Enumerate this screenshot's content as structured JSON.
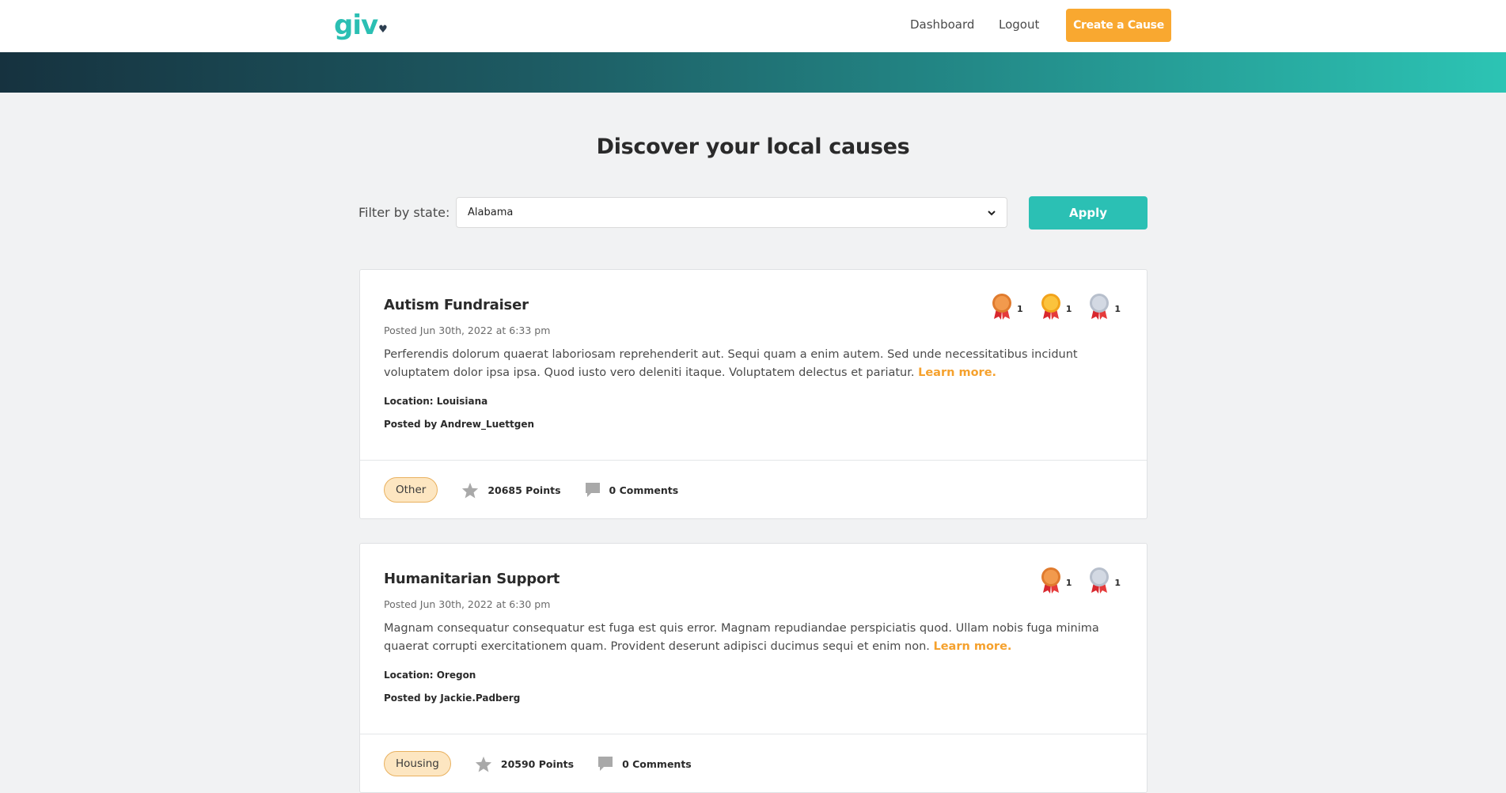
{
  "nav": {
    "logo_text": "giv",
    "logo_heart": "♥",
    "dashboard": "Dashboard",
    "logout": "Logout",
    "create_cause": "Create a Cause"
  },
  "page": {
    "title": "Discover your local causes"
  },
  "filter": {
    "label": "Filter by state:",
    "selected": "Alabama",
    "apply": "Apply"
  },
  "colors": {
    "brand_teal": "#2bc0b4",
    "accent_orange": "#f9a830",
    "tag_bg": "#fde6c1"
  },
  "causes": [
    {
      "title": "Autism Fundraiser",
      "posted": "Posted Jun 30th, 2022 at 6:33 pm",
      "description": "Perferendis dolorum quaerat laboriosam reprehenderit aut. Sequi quam a enim autem. Sed unde necessitatibus incidunt voluptatem dolor ipsa ipsa. Quod iusto vero deleniti itaque. Voluptatem delectus et pariatur.",
      "learn_more": "Learn more.",
      "location": "Location: Louisiana",
      "posted_by": "Posted by Andrew_Luettgen",
      "medals": [
        {
          "type": "bronze",
          "count": "1"
        },
        {
          "type": "gold",
          "count": "1"
        },
        {
          "type": "silver",
          "count": "1"
        }
      ],
      "tag": "Other",
      "points": "20685 Points",
      "comments": "0 Comments"
    },
    {
      "title": "Humanitarian Support",
      "posted": "Posted Jun 30th, 2022 at 6:30 pm",
      "description": "Magnam consequatur consequatur est fuga est quis error. Magnam repudiandae perspiciatis quod. Ullam nobis fuga minima quaerat corrupti exercitationem quam. Provident deserunt adipisci ducimus sequi et enim non.",
      "learn_more": "Learn more.",
      "location": "Location: Oregon",
      "posted_by": "Posted by Jackie.Padberg",
      "medals": [
        {
          "type": "bronze",
          "count": "1"
        },
        {
          "type": "silver",
          "count": "1"
        }
      ],
      "tag": "Housing",
      "points": "20590 Points",
      "comments": "0 Comments"
    }
  ]
}
